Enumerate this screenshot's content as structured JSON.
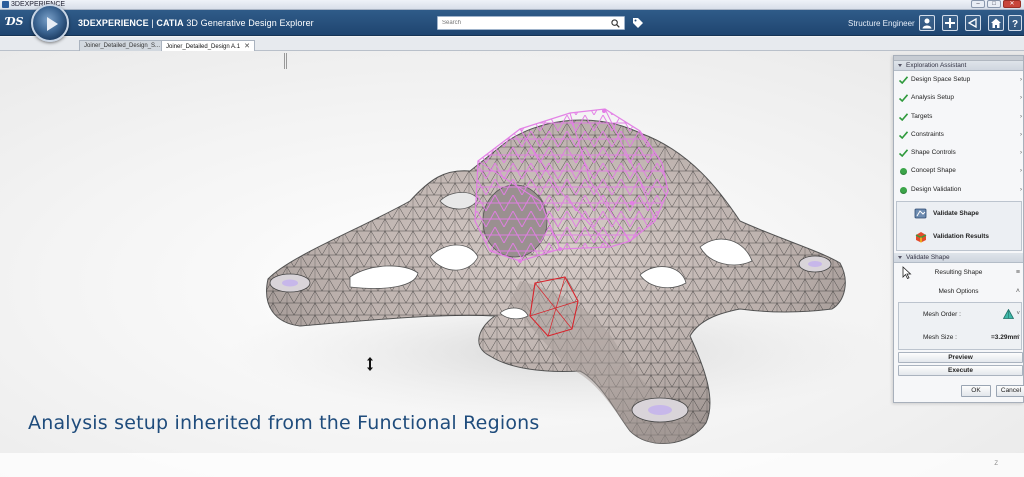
{
  "os_window": {
    "title": "3DEXPERIENCE",
    "minimize_glyph": "–",
    "maximize_glyph": "□",
    "close_glyph": "✕"
  },
  "header": {
    "logo_text": "ƊS",
    "app_brand": "3DEXPERIENCE",
    "app_separator": " | ",
    "app_product": "CATIA",
    "app_name": " 3D Generative Design Explorer",
    "search_placeholder": "Search",
    "user_role": "Structure Engineer",
    "buttons": [
      "user-icon",
      "add-icon",
      "share-icon",
      "home-icon",
      "help-icon"
    ]
  },
  "tabs": [
    {
      "label": "Joiner_Detailed_Design_S...",
      "active": false
    },
    {
      "label": "Joiner_Detailed_Design A.1",
      "active": true,
      "close": "✕"
    }
  ],
  "viewport": {
    "caption": "Analysis setup inherited from the Functional Regions",
    "corner_mark": "Z"
  },
  "assistant": {
    "title": "Exploration Assistant",
    "steps": [
      {
        "label": "Design Space Setup",
        "status": "done"
      },
      {
        "label": "Analysis Setup",
        "status": "done"
      },
      {
        "label": "Targets",
        "status": "done"
      },
      {
        "label": "Constraints",
        "status": "done"
      },
      {
        "label": "Shape Controls",
        "status": "done"
      },
      {
        "label": "Concept Shape",
        "status": "active"
      },
      {
        "label": "Design Validation",
        "status": "active"
      }
    ],
    "sub_actions": [
      {
        "label": "Validate Shape",
        "icon": "validate-shape-icon"
      },
      {
        "label": "Validation Results",
        "icon": "validation-results-icon"
      }
    ]
  },
  "validate_shape": {
    "title": "Validate Shape",
    "resulting_shape": "Resulting Shape",
    "mesh_options": "Mesh Options",
    "mesh_order_label": "Mesh Order :",
    "mesh_size_label": "Mesh Size :",
    "mesh_size_value": "=3.29mm",
    "preview_label": "Preview",
    "execute_label": "Execute",
    "ok_label": "OK",
    "cancel_label": "Cancel"
  },
  "colors": {
    "header_blue": "#244b77",
    "caption_blue": "#1f4c7c",
    "check_green": "#2f9a3c",
    "region_pink": "#e37ee6",
    "region_red": "#d8242c",
    "mesh_surface": "#c3b8b4"
  }
}
